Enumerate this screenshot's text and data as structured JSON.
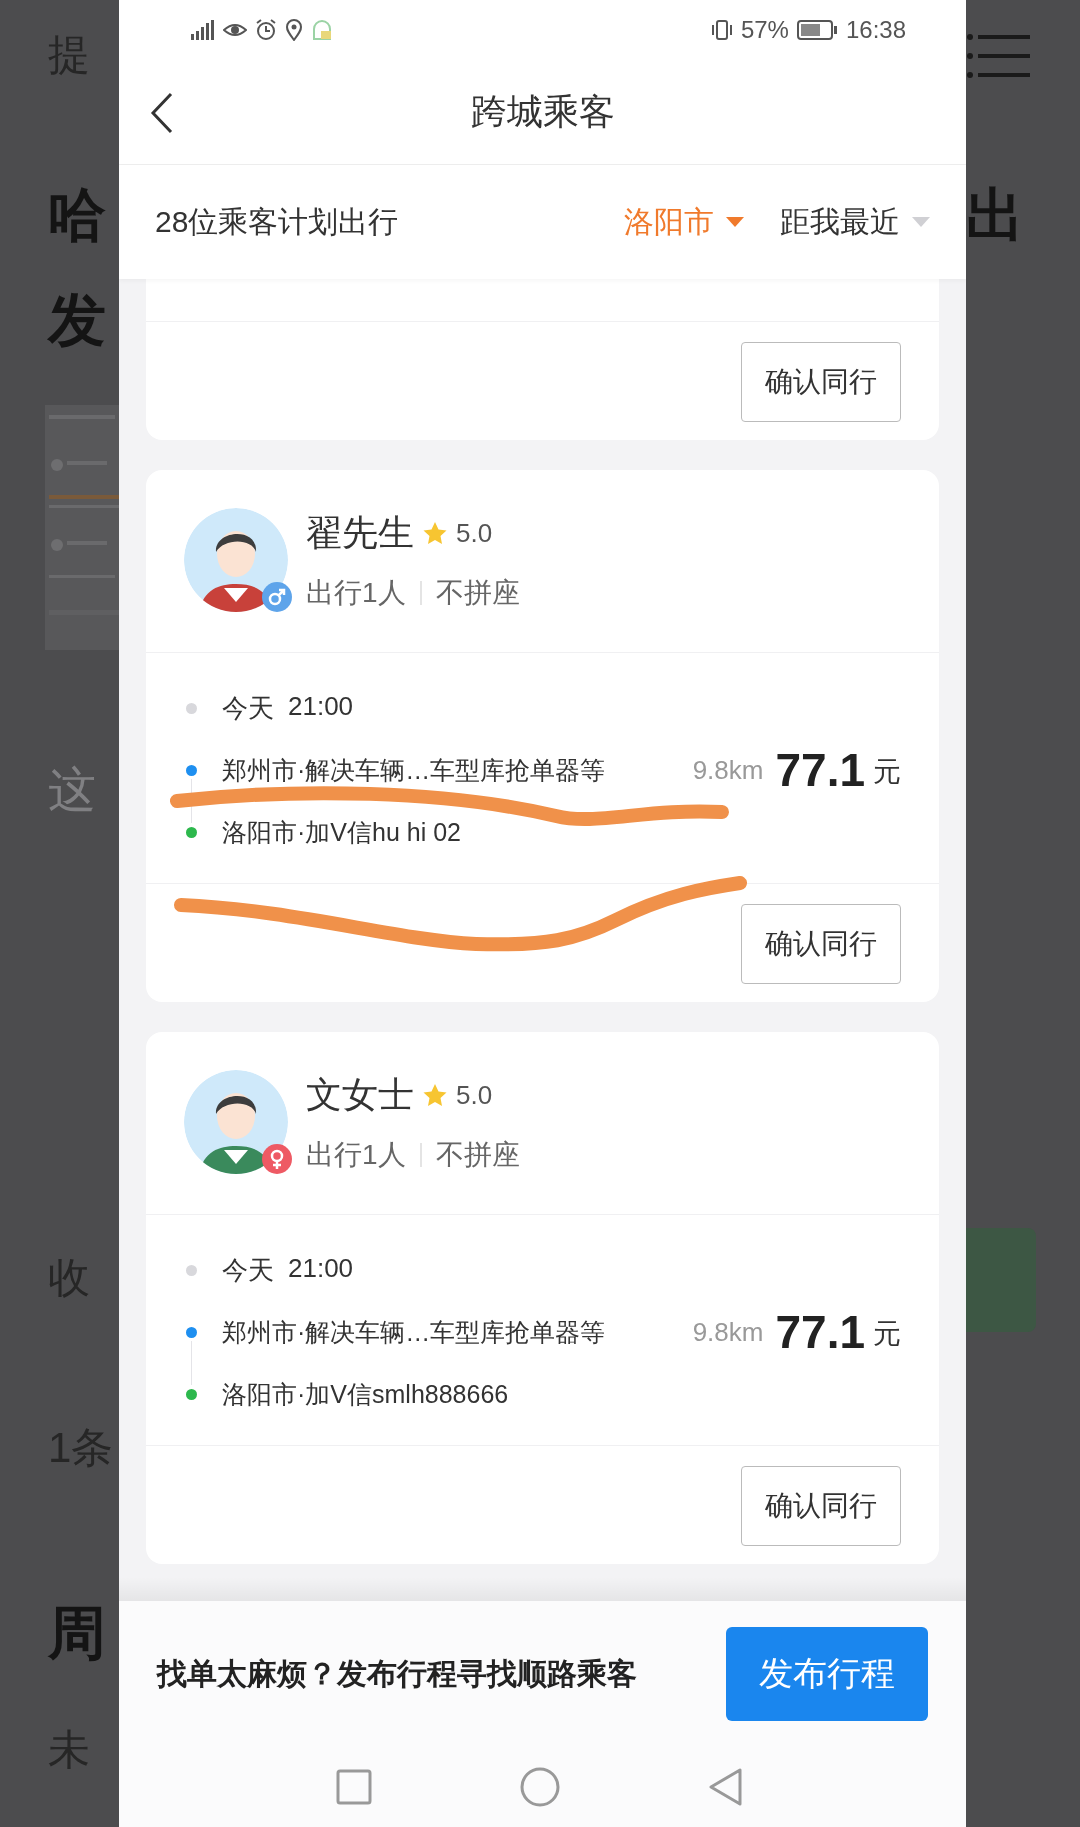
{
  "background_page": {
    "left": [
      {
        "kind": "label",
        "text": "提"
      },
      {
        "kind": "heading",
        "text": "哈"
      },
      {
        "kind": "heading",
        "text": "发"
      },
      {
        "kind": "picture"
      },
      {
        "kind": "faint",
        "text": "这"
      },
      {
        "kind": "label",
        "text": "收"
      },
      {
        "kind": "label",
        "text": "1条"
      },
      {
        "kind": "heading",
        "text": "周"
      },
      {
        "kind": "label",
        "text": "未"
      }
    ],
    "right": [
      {
        "kind": "menu"
      },
      {
        "kind": "heading",
        "text": "出"
      },
      {
        "kind": "button"
      }
    ]
  },
  "status_bar": {
    "battery": "57%",
    "time": "16:38"
  },
  "header": {
    "title": "跨城乘客"
  },
  "filter_bar": {
    "summary": "28位乘客计划出行",
    "filters": [
      {
        "label": "洛阳市",
        "selected": true
      },
      {
        "label": "距我最近",
        "selected": false
      }
    ]
  },
  "passengers": [
    {
      "kind": "partial",
      "button": "确认同行"
    },
    {
      "kind": "male",
      "name": "翟先生",
      "rating": "5.0",
      "seats": "出行1人",
      "carpool": "不拼座",
      "day": "今天",
      "time": "21:00",
      "stops": [
        {
          "text": "郑州市·解决车辆…车型库抢单器等",
          "color": "#1e8ff0"
        },
        {
          "text": "洛阳市·加V信hu hi 02",
          "color": "#2db84d"
        }
      ],
      "distance": "9.8km",
      "price": "77.1",
      "currency": "元",
      "button": "确认同行",
      "annotated": true
    },
    {
      "kind": "female",
      "name": "文女士",
      "rating": "5.0",
      "seats": "出行1人",
      "carpool": "不拼座",
      "day": "今天",
      "time": "21:00",
      "stops": [
        {
          "text": "郑州市·解决车辆…车型库抢单器等",
          "color": "#1e8ff0"
        },
        {
          "text": "洛阳市·加V信smlh888666",
          "color": "#2db84d"
        }
      ],
      "distance": "9.8km",
      "price": "77.1",
      "currency": "元",
      "button": "确认同行",
      "annotated": false
    }
  ],
  "footer": {
    "prompt": "找单太麻烦？发布行程寻找顺路乘客",
    "button": "发布行程"
  }
}
